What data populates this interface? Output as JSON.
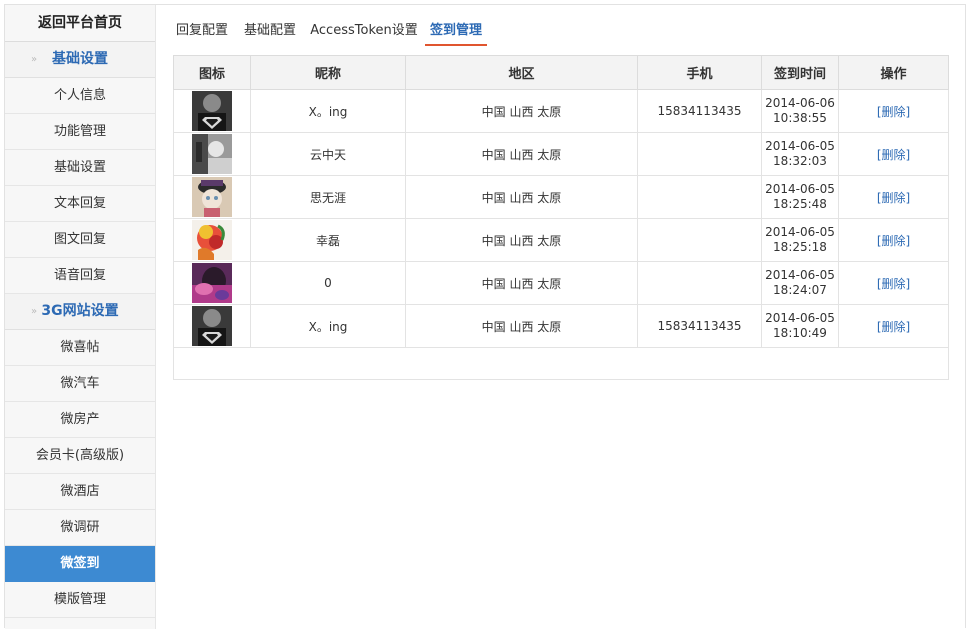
{
  "sidebar": {
    "home": "返回平台首页",
    "section1": "基础设置",
    "section2": "3G网站设置",
    "chevron": "»",
    "items1": [
      "个人信息",
      "功能管理",
      "基础设置",
      "文本回复",
      "图文回复",
      "语音回复"
    ],
    "items2": [
      "微喜帖",
      "微汽车",
      "微房产",
      "会员卡(高级版)",
      "微酒店",
      "微调研",
      "微签到",
      "模版管理"
    ],
    "active_item": "微签到"
  },
  "tabs": [
    {
      "label": "回复配置"
    },
    {
      "label": "基础配置"
    },
    {
      "label": "AccessToken设置"
    },
    {
      "label": "签到管理",
      "active": true
    }
  ],
  "table": {
    "headers": [
      "图标",
      "昵称",
      "地区",
      "手机",
      "签到时间",
      "操作"
    ],
    "rows": [
      {
        "avatar": "superman-avatar",
        "nick": "X。ing",
        "region": "中国 山西 太原",
        "phone": "15834113435",
        "date": "2014-06-06",
        "time": "10:38:55",
        "action": "[删除]"
      },
      {
        "avatar": "bw-photo-avatar",
        "nick": "云中天",
        "region": "中国 山西 太原",
        "phone": "",
        "date": "2014-06-05",
        "time": "18:32:03",
        "action": "[删除]"
      },
      {
        "avatar": "cat-avatar",
        "nick": "思无涯",
        "region": "中国 山西 太原",
        "phone": "",
        "date": "2014-06-05",
        "time": "18:25:48",
        "action": "[删除]"
      },
      {
        "avatar": "colorful-avatar",
        "nick": "幸磊",
        "region": "中国 山西 太原",
        "phone": "",
        "date": "2014-06-05",
        "time": "18:25:18",
        "action": "[删除]"
      },
      {
        "avatar": "purple-avatar",
        "nick": "0",
        "region": "中国 山西 太原",
        "phone": "",
        "date": "2014-06-05",
        "time": "18:24:07",
        "action": "[删除]"
      },
      {
        "avatar": "superman-avatar",
        "nick": "X。ing",
        "region": "中国 山西 太原",
        "phone": "15834113435",
        "date": "2014-06-05",
        "time": "18:10:49",
        "action": "[删除]"
      }
    ]
  },
  "colors": {
    "accent": "#2d6ab4",
    "active_bg": "#3d8ad2",
    "tab_underline": "#e0552f"
  }
}
